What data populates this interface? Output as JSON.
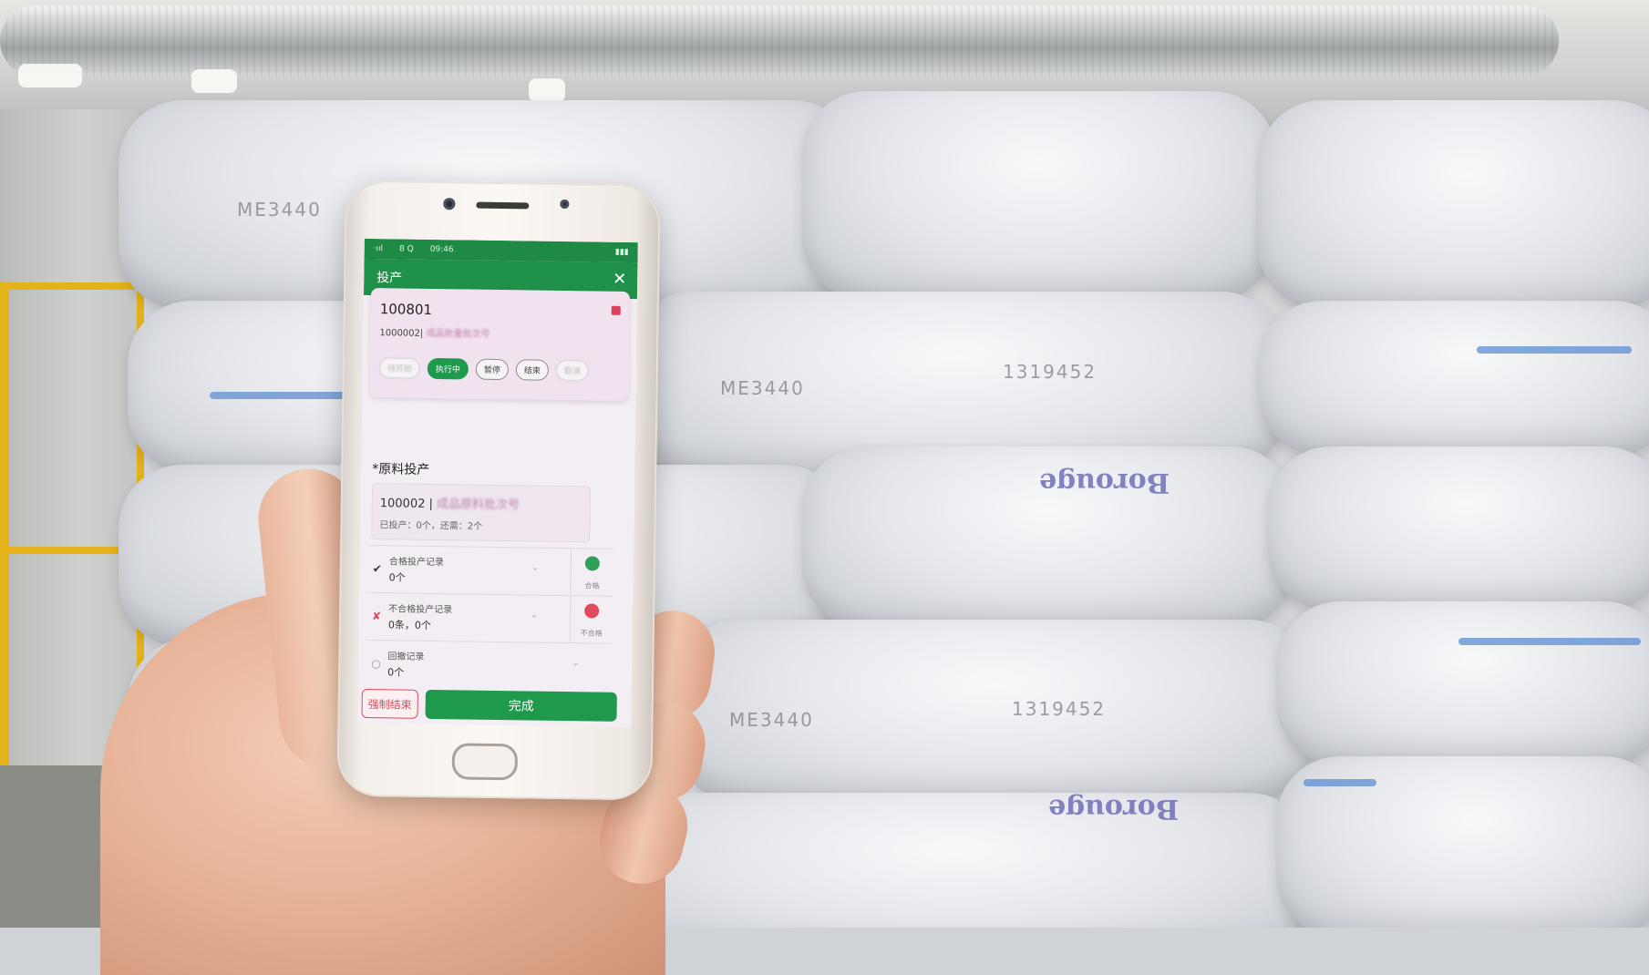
{
  "scene": {
    "bag_print_code": "ME3440",
    "bag_print_lot": "1319452",
    "bag_brand": "Borouge"
  },
  "status_bar": {
    "left": "·ııl",
    "mid": "8 Q",
    "time": "09:46",
    "right": "▮▮▮"
  },
  "app": {
    "title": "投产",
    "close_icon": "close-icon",
    "order": {
      "code": "100801",
      "subtitle_prefix": "1000002|",
      "subtitle_rest": "成品批量批次号"
    },
    "states": [
      "待开始",
      "执行中",
      "暂停",
      "结束",
      "取消"
    ],
    "active_state_index": 1,
    "section_title": "*原料投产",
    "material": {
      "code": "100002 |",
      "name": "成品原料批次号",
      "stats": "已投产：0个，还需：2个"
    },
    "records": [
      {
        "label": "合格投产记录",
        "value": "0个",
        "side": "合格",
        "icon": "check-icon",
        "color": "#2fa05a"
      },
      {
        "label": "不合格投产记录",
        "value": "0条，0个",
        "side": "不合格",
        "icon": "cross-icon",
        "color": "#e04a5c"
      },
      {
        "label": "回撤记录",
        "value": "0个",
        "icon": "circle-icon"
      }
    ],
    "force_end_label": "强制结束",
    "done_label": "完成"
  },
  "colors": {
    "accent_green": "#1f9a4d",
    "danger_red": "#e04a5c"
  }
}
